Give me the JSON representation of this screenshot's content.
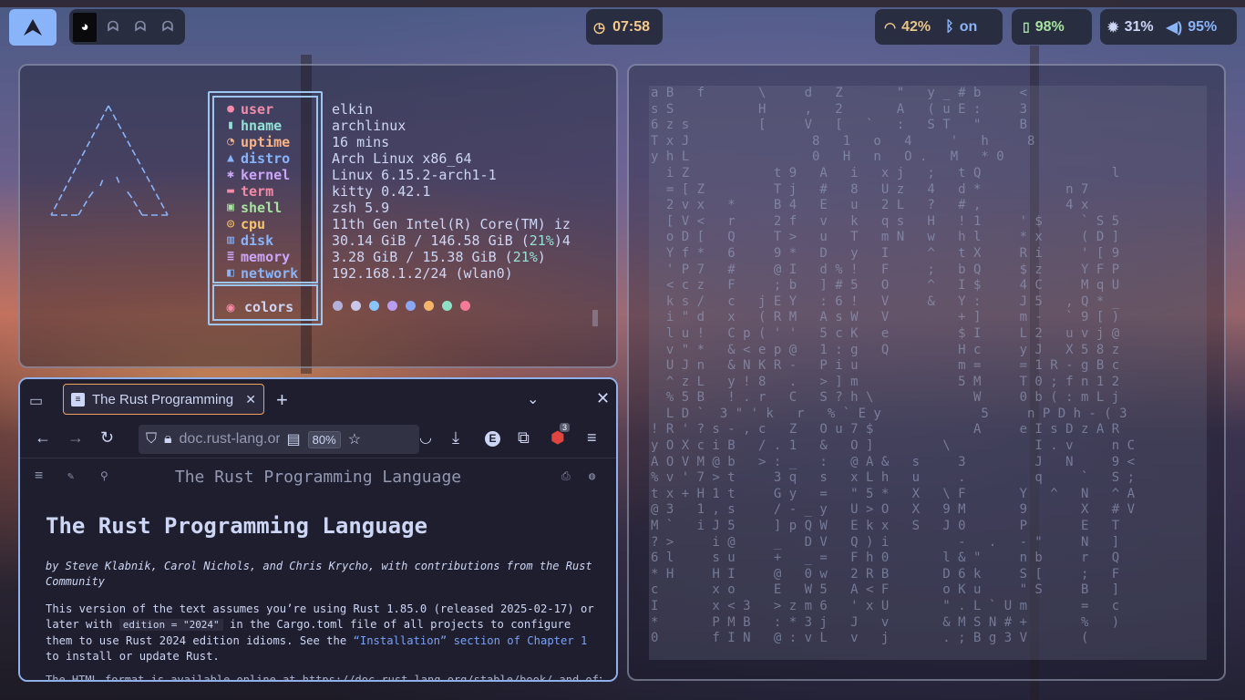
{
  "topbar": {
    "workspaces": [
      "active-ghost",
      "ghost",
      "ghost",
      "ghost"
    ],
    "clock": "07:58",
    "wifi": "42%",
    "bluetooth": "on",
    "battery": "98%",
    "brightness": "31%",
    "volume": "95%"
  },
  "fetch": {
    "rows": [
      {
        "key": "user",
        "icon": "user-icon",
        "color": "#f38ba8",
        "value": "elkin"
      },
      {
        "key": "hname",
        "icon": "phone-icon",
        "color": "#94e2d5",
        "value": "archlinux"
      },
      {
        "key": "uptime",
        "icon": "clock-icon",
        "color": "#fab387",
        "value": "16 mins"
      },
      {
        "key": "distro",
        "icon": "arch-icon",
        "color": "#89b4fa",
        "value": "Arch Linux x86_64"
      },
      {
        "key": "kernel",
        "icon": "gear-icon",
        "color": "#cba6f7",
        "value": "Linux 6.15.2-arch1-1"
      },
      {
        "key": "term",
        "icon": "terminal-icon",
        "color": "#f38ba8",
        "value": "kitty 0.42.1"
      },
      {
        "key": "shell",
        "icon": "shell-icon",
        "color": "#a6e3a1",
        "value": "zsh 5.9"
      },
      {
        "key": "cpu",
        "icon": "cpu-icon",
        "color": "#f9c46b",
        "value": "11th Gen Intel(R) Core(TM) iz"
      },
      {
        "key": "disk",
        "icon": "disk-icon",
        "color": "#89b4fa",
        "value": "30.14 GiB / 146.58 GiB (",
        "pct": "21%",
        "tail": ")4"
      },
      {
        "key": "memory",
        "icon": "memory-icon",
        "color": "#cba6f7",
        "value": "3.28 GiB / 15.38 GiB (",
        "pct": "21%",
        "tail": ")"
      },
      {
        "key": "network",
        "icon": "network-icon",
        "color": "#89b4fa",
        "value": "192.168.1.2/24 (wlan0)"
      }
    ],
    "colors_label": "colors",
    "palette": [
      "#b4b0d9",
      "#c9c6e8",
      "#89c4fa",
      "#b79cf0",
      "#8aa6f5",
      "#f5b46a",
      "#8de0c6",
      "#f57a98"
    ]
  },
  "matrix": {
    "lines": [
      "a B   f       \\     d   Z       \"   y _ # b     <",
      "s S           H     ,   2       A   ( u E :     3",
      "6 z s         [     V   [   `   :   S T   \"     B",
      "T x J                8   1   o   4     '   h     8",
      "y h L                0   H   n   O .   M   * 0",
      "  i Z           t 9   A   i   x j   ;   t Q                 l",
      "  = [ Z         T j   #   8   U z   4   d *           n 7",
      "  2 v x   *     B 4   E   u   2 L   ?   # ,           4 x",
      "  [ V <   r     2 f   v   k   q s   H   ! 1     ' $     ` S 5",
      "  o D [   Q     T >   u   T   m N   w   h l     * x     ( D ]",
      "  Y f *   6     9 *   D   y   I     ^   t X     R i     ' [ 9",
      "  ' P 7   #     @ I   d % !   F     ;   b Q     $ z     Y F P",
      "  < c z   F     ; b   ] # 5   O     ^   I $     4 C     M q U",
      "  k s /   c   j E Y   : 6 !   V     &   Y :     J 5   , Q * _",
      "  i \" d   x   ( R M   A s W   V         + ]     m -   ` 9 [ )",
      "  l u !   C p ( ' '   5 c K   e         $ I     L 2   u v j @",
      "  v \" *   & < e p @   1 : g   Q         H c     y J   X 5 8 z",
      "  U J n   & N K R -   P i u             m =     = 1 R - g B c",
      "  ^ z L   y ! 8   .   > ] m             5 M     T 0 ; f n 1 2",
      "  % 5 B   ! . r   C   S ? h \\             W     0 b ( : m L j",
      "  L D `  3 \" ' k   r   % ` E y             5     n P D h - ( 3",
      "! R ' ? s - , c   Z   O u 7 $             A     e I s D z A R",
      "y O X c i B   / . 1   &   O ]         \\           I . v     n C",
      "A O V M @ b   > : _   :   @ A &   s     3         J   N     9 <",
      "% v ' 7 > t     3 q   s   x L h   u     .         q     `   S ;",
      "t x + H 1 t     G y   =   \" 5 *   X   \\ F       Y   ^   N   ^ A",
      "@ 3   1 , s     / - _ y   U > O   X   9 M       9       X   # V",
      "M `   i J 5     ] p Q W   E k x   S   J 0       P       E   T",
      "? >     i @     _   D V   Q ) i         -   .   - \"     N   ]",
      "6 l     s u     +   _ =   F h 0       l & \"     n b     r   Q",
      "* H     H I     @   0 w   2 R B       D 6 k     S [     ;   F",
      "c       x o     E   W 5   A < F       o K u     \" S     B   ]",
      "I       x < 3   > z m 6   ' x U       \" . L ` U m       =   c",
      "*       P M B   : * 3 j   J   v       & M S N # +       %   )",
      "0       f I N   @ : v L   v   j       . ; B g 3 V       ("
    ]
  },
  "browser": {
    "tab_title": "The Rust Programming Language",
    "url": "doc.rust-lang.org",
    "zoom": "80%",
    "ext_badge": "3",
    "ext_e": "E",
    "doc_header": "The Rust Programming Language",
    "h1": "The Rust Programming Language",
    "byline": "by Steve Klabnik, Carol Nichols, and Chris Krycho, with contributions from the Rust Community",
    "para_a": "This version of the text assumes you’re using Rust 1.85.0 (released 2025-02-17) or later with ",
    "para_code": "edition = \"2024\"",
    "para_b": " in the Cargo.toml file of all projects to configure them to use Rust 2024 edition idioms. See the ",
    "para_link": "“Installation” section of Chapter 1",
    "para_c": " to install or update Rust.",
    "para2": "The HTML format is available online at https://doc.rust-lang.org/stable/book/ and offline"
  }
}
